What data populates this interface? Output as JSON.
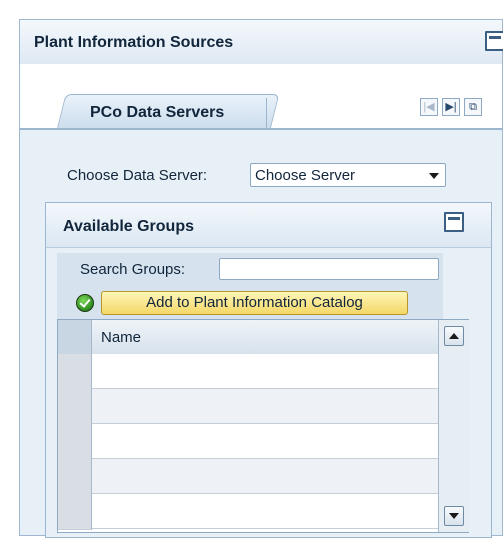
{
  "panel": {
    "title": "Plant Information Sources"
  },
  "tabs": [
    {
      "label": "PCo Data Servers",
      "active": true
    }
  ],
  "tab_nav": {
    "first_icon": "first-page-icon",
    "last_icon": "last-page-icon",
    "menu_icon": "tab-list-icon"
  },
  "data_server": {
    "label": "Choose Data Server:",
    "selected": "Choose Server"
  },
  "groups": {
    "title": "Available Groups",
    "search_label": "Search Groups:",
    "search_value": "",
    "add_button_label": "Add to Plant Information Catalog",
    "table": {
      "columns": [
        "Name"
      ],
      "rows": [
        "",
        "",
        "",
        "",
        ""
      ]
    }
  },
  "colors": {
    "panel_bg": "#e8f0f7",
    "header_text": "#11253b",
    "button_yellow": "#f3d766",
    "ok_green": "#2c8a1e"
  }
}
